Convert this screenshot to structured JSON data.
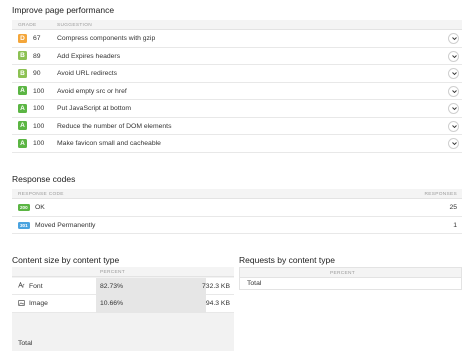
{
  "performance": {
    "title": "Improve page performance",
    "col_grade": "GRADE",
    "col_suggestion": "SUGGESTION",
    "rows": [
      {
        "grade": "D",
        "score": "67",
        "suggestion": "Compress components with gzip",
        "color": "#f4a63a"
      },
      {
        "grade": "B",
        "score": "89",
        "suggestion": "Add Expires headers",
        "color": "#8cc153"
      },
      {
        "grade": "B",
        "score": "90",
        "suggestion": "Avoid URL redirects",
        "color": "#8cc153"
      },
      {
        "grade": "A",
        "score": "100",
        "suggestion": "Avoid empty src or href",
        "color": "#5bb543"
      },
      {
        "grade": "A",
        "score": "100",
        "suggestion": "Put JavaScript at bottom",
        "color": "#5bb543"
      },
      {
        "grade": "A",
        "score": "100",
        "suggestion": "Reduce the number of DOM elements",
        "color": "#5bb543"
      },
      {
        "grade": "A",
        "score": "100",
        "suggestion": "Make favicon small and cacheable",
        "color": "#5bb543"
      }
    ]
  },
  "responses": {
    "title": "Response codes",
    "col_code": "RESPONSE CODE",
    "col_responses": "RESPONSES",
    "rows": [
      {
        "code": "200",
        "label": "OK",
        "count": "25",
        "color": "#5bb543"
      },
      {
        "code": "301",
        "label": "Moved Permanently",
        "count": "1",
        "color": "#4aa3df"
      }
    ]
  },
  "content_size": {
    "title": "Content size by content type",
    "col_percent": "PERCENT",
    "rows": [
      {
        "icon": "font-icon",
        "label": "Font",
        "percent": "82.73%",
        "size": "732.3 KB"
      },
      {
        "icon": "image-icon",
        "label": "Image",
        "percent": "10.66%",
        "size": "94.3 KB"
      }
    ],
    "total_label": "Total"
  },
  "requests": {
    "title": "Requests by content type",
    "col_percent": "PERCENT",
    "total_label": "Total"
  }
}
